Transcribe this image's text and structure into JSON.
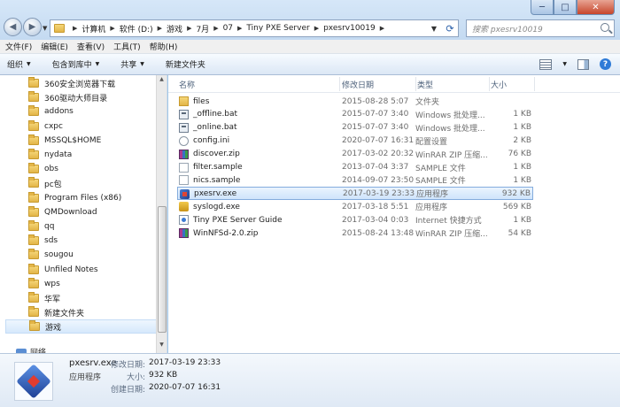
{
  "window": {
    "minimize": "─",
    "maximize": "□",
    "close": "✕"
  },
  "address": {
    "crumbs": [
      "计算机",
      "软件 (D:)",
      "游戏",
      "7月",
      "07",
      "Tiny PXE Server",
      "pxesrv10019"
    ],
    "search_placeholder": "搜索 pxesrv10019"
  },
  "menu": [
    "文件(F)",
    "编辑(E)",
    "查看(V)",
    "工具(T)",
    "帮助(H)"
  ],
  "commands": {
    "organize": "组织",
    "include_in_library": "包含到库中",
    "share": "共享",
    "new_folder": "新建文件夹"
  },
  "nav": {
    "folders": [
      "360安全浏览器下载",
      "360驱动大师目录",
      "addons",
      "cxpc",
      "MSSQL$HOME",
      "nydata",
      "obs",
      "pc包",
      "Program Files (x86)",
      "QMDownload",
      "qq",
      "sds",
      "sougou",
      "Unfiled Notes",
      "wps",
      "华军",
      "新建文件夹",
      "游戏"
    ],
    "selected": "游戏",
    "network": "网络"
  },
  "columns": {
    "name": "名称",
    "date": "修改日期",
    "type": "类型",
    "size": "大小"
  },
  "files": [
    {
      "name": "files",
      "date": "2015-08-28 5:07",
      "type": "文件夹",
      "size": "",
      "icon": "folder-icon"
    },
    {
      "name": "_offline.bat",
      "date": "2015-07-07 3:40",
      "type": "Windows 批处理...",
      "size": "1 KB",
      "icon": "batch-file-icon"
    },
    {
      "name": "_online.bat",
      "date": "2015-07-07 3:40",
      "type": "Windows 批处理...",
      "size": "1 KB",
      "icon": "batch-file-icon"
    },
    {
      "name": "config.ini",
      "date": "2020-07-07 16:31",
      "type": "配置设置",
      "size": "2 KB",
      "icon": "config-file-icon"
    },
    {
      "name": "discover.zip",
      "date": "2017-03-02 20:32",
      "type": "WinRAR ZIP 压缩...",
      "size": "76 KB",
      "icon": "zip-archive-icon"
    },
    {
      "name": "filter.sample",
      "date": "2013-07-04 3:37",
      "type": "SAMPLE 文件",
      "size": "1 KB",
      "icon": "document-icon"
    },
    {
      "name": "nics.sample",
      "date": "2014-09-07 23:50",
      "type": "SAMPLE 文件",
      "size": "1 KB",
      "icon": "document-icon"
    },
    {
      "name": "pxesrv.exe",
      "date": "2017-03-19 23:33",
      "type": "应用程序",
      "size": "932 KB",
      "icon": "pxesrv-app-icon"
    },
    {
      "name": "syslogd.exe",
      "date": "2017-03-18 5:51",
      "type": "应用程序",
      "size": "569 KB",
      "icon": "syslogd-app-icon"
    },
    {
      "name": "Tiny PXE Server Guide",
      "date": "2017-03-04 0:03",
      "type": "Internet 快捷方式",
      "size": "1 KB",
      "icon": "internet-shortcut-icon"
    },
    {
      "name": "WinNFSd-2.0.zip",
      "date": "2015-08-24 13:48",
      "type": "WinRAR ZIP 压缩...",
      "size": "54 KB",
      "icon": "zip-archive-icon"
    }
  ],
  "selected_file": "pxesrv.exe",
  "details": {
    "name": "pxesrv.exe",
    "type": "应用程序",
    "modified_label": "修改日期:",
    "modified": "2017-03-19 23:33",
    "size_label": "大小:",
    "size": "932 KB",
    "created_label": "创建日期:",
    "created": "2020-07-07 16:31"
  }
}
